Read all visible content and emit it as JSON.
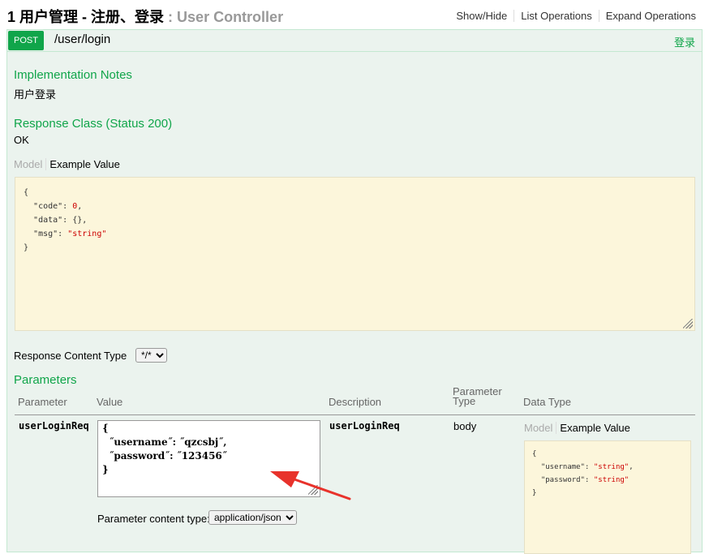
{
  "header": {
    "number": "1",
    "title": "用户管理 - 注册、登录",
    "subtitle": ": User Controller",
    "links": [
      "Show/Hide",
      "List Operations",
      "Expand Operations"
    ]
  },
  "operation": {
    "method": "POST",
    "path": "/user/login",
    "summary": "登录"
  },
  "implementation": {
    "heading": "Implementation Notes",
    "text": "用户登录"
  },
  "response_class": {
    "heading": "Response Class (Status 200)",
    "text": "OK",
    "tab_model": "Model",
    "tab_example": "Example Value",
    "example_lines": [
      {
        "indent": "",
        "key": "{",
        "value": ""
      },
      {
        "indent": "  ",
        "key": "\"code\": ",
        "value": "0",
        "tail": ","
      },
      {
        "indent": "  ",
        "key": "\"data\": {},",
        "value": ""
      },
      {
        "indent": "  ",
        "key": "\"msg\": ",
        "value": "\"string\"",
        "tail": ""
      },
      {
        "indent": "",
        "key": "}",
        "value": ""
      }
    ]
  },
  "response_content_type": {
    "label": "Response Content Type",
    "selected": "*/*"
  },
  "parameters": {
    "heading": "Parameters",
    "columns": [
      "Parameter",
      "Value",
      "Description",
      "Parameter Type",
      "Data Type"
    ],
    "column_type_line1": "Parameter",
    "column_type_line2": "Type",
    "row": {
      "name": "userLoginReq",
      "value_lines": [
        "{",
        "  ˝username˝: ˝qzcsbj˝,",
        "  ˝password˝: ˝123456˝",
        "}"
      ],
      "description": "userLoginReq",
      "type": "body",
      "tab_model": "Model",
      "tab_example": "Example Value",
      "data_example_lines": [
        "{",
        "  \"username\": ",
        "\"string\"",
        ",",
        "  \"password\": ",
        "\"string\"",
        "}"
      ]
    },
    "content_type_label": "Parameter content type:",
    "content_type_selected": "application/json"
  },
  "colors": {
    "accent": "#10a54a",
    "panel_bg": "#ebf3ee",
    "code_bg": "#fcf6db",
    "arrow": "#e8322b"
  }
}
